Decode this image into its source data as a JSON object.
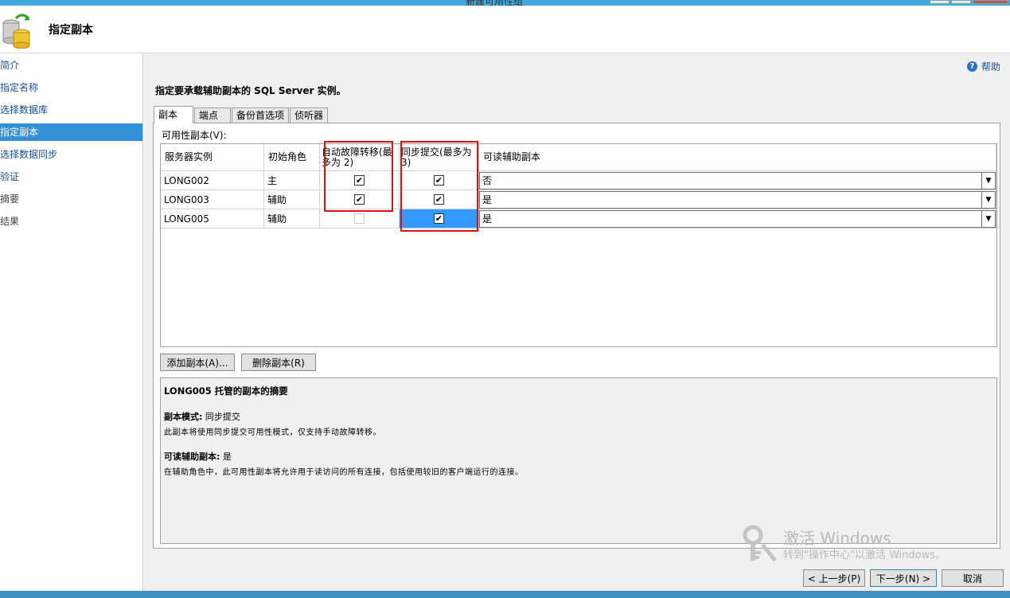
{
  "window": {
    "title": "新建可用性组"
  },
  "header": {
    "title": "指定副本"
  },
  "nav": {
    "items": [
      {
        "label": "简介",
        "state": "normal"
      },
      {
        "label": "指定名称",
        "state": "normal"
      },
      {
        "label": "选择数据库",
        "state": "normal"
      },
      {
        "label": "指定副本",
        "state": "active"
      },
      {
        "label": "选择数据同步",
        "state": "normal"
      },
      {
        "label": "验证",
        "state": "normal"
      },
      {
        "label": "摘要",
        "state": "disabled"
      },
      {
        "label": "结果",
        "state": "disabled"
      }
    ]
  },
  "help": {
    "label": "帮助"
  },
  "instruction": "指定要承载辅助副本的 SQL Server 实例。",
  "tabs": [
    {
      "label": "副本",
      "active": true
    },
    {
      "label": "端点",
      "active": false
    },
    {
      "label": "备份首选项",
      "active": false
    },
    {
      "label": "侦听器",
      "active": false
    }
  ],
  "grid": {
    "label": "可用性副本(V):",
    "columns": [
      "服务器实例",
      "初始角色",
      "自动故障转移(最多为 2)",
      "同步提交(最多为 3)",
      "可读辅助副本"
    ],
    "rows": [
      {
        "server": "LONG002",
        "role": "主",
        "auto_failover": true,
        "auto_failover_enabled": true,
        "sync_commit": true,
        "readable": "否"
      },
      {
        "server": "LONG003",
        "role": "辅助",
        "auto_failover": true,
        "auto_failover_enabled": true,
        "sync_commit": true,
        "readable": "是"
      },
      {
        "server": "LONG005",
        "role": "辅助",
        "auto_failover": false,
        "auto_failover_enabled": false,
        "sync_commit": true,
        "readable": "是"
      }
    ]
  },
  "buttons": {
    "add_replica": "添加副本(A)...",
    "remove_replica": "删除副本(R)",
    "prev": "< 上一步(P)",
    "next": "下一步(N) >",
    "cancel": "取消"
  },
  "summary": {
    "title": "LONG005 托管的副本的摘要",
    "mode_label": "副本模式:",
    "mode_value": "同步提交",
    "mode_desc": "此副本将使用同步提交可用性模式，仅支持手动故障转移。",
    "readable_label": "可读辅助副本:",
    "readable_value": "是",
    "readable_desc": "在辅助角色中，此可用性副本将允许用于读访问的所有连接，包括使用较旧的客户端运行的连接。"
  },
  "watermark": {
    "line1": "激活 Windows",
    "line2": "转到\"操作中心\"以激活 Windows。"
  },
  "colors": {
    "accent": "#3390d7",
    "highlight": "#e01010",
    "selection": "#3399ff"
  }
}
